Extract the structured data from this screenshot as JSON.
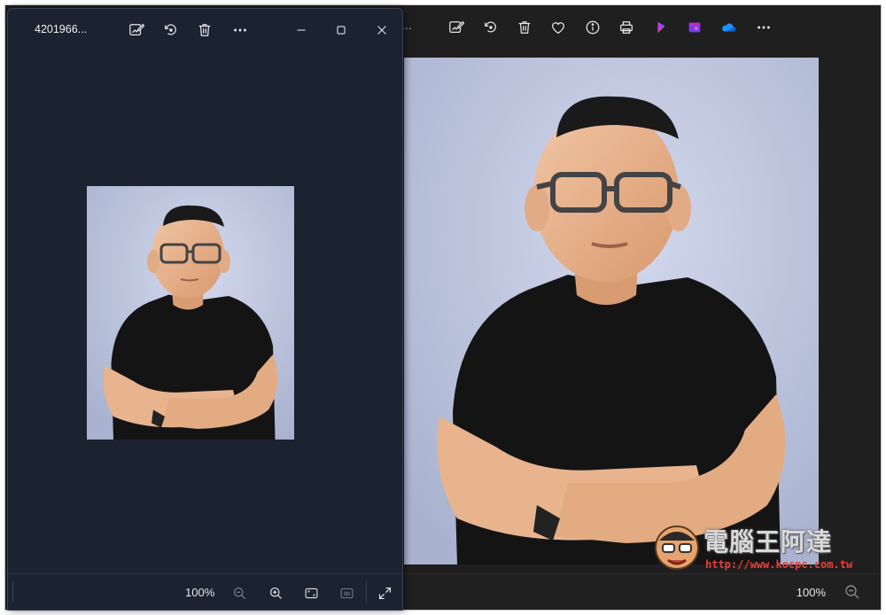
{
  "front_window": {
    "title": "4201966...",
    "toolbar_icons": [
      "edit-image-icon",
      "rotate-icon",
      "delete-icon",
      "more-icon"
    ],
    "window_controls": [
      "minimize-icon",
      "maximize-icon",
      "close-icon"
    ],
    "status": {
      "zoom": "100%"
    }
  },
  "main_window": {
    "ellipsis": "...",
    "toolbar_icons": [
      "edit-image-icon",
      "rotate-icon",
      "delete-icon",
      "favorite-icon",
      "info-icon",
      "print-icon",
      "clipchamp-icon",
      "designer-icon",
      "onedrive-icon",
      "more-icon"
    ],
    "status": {
      "zoom": "100%"
    }
  },
  "watermark": {
    "text": "電腦王阿達",
    "url": "http://www.kocpc.com.tw"
  },
  "colors": {
    "background": "#1f1f1f",
    "front_window": "#1b2230",
    "photo_backdrop": "#b9c2dc"
  }
}
